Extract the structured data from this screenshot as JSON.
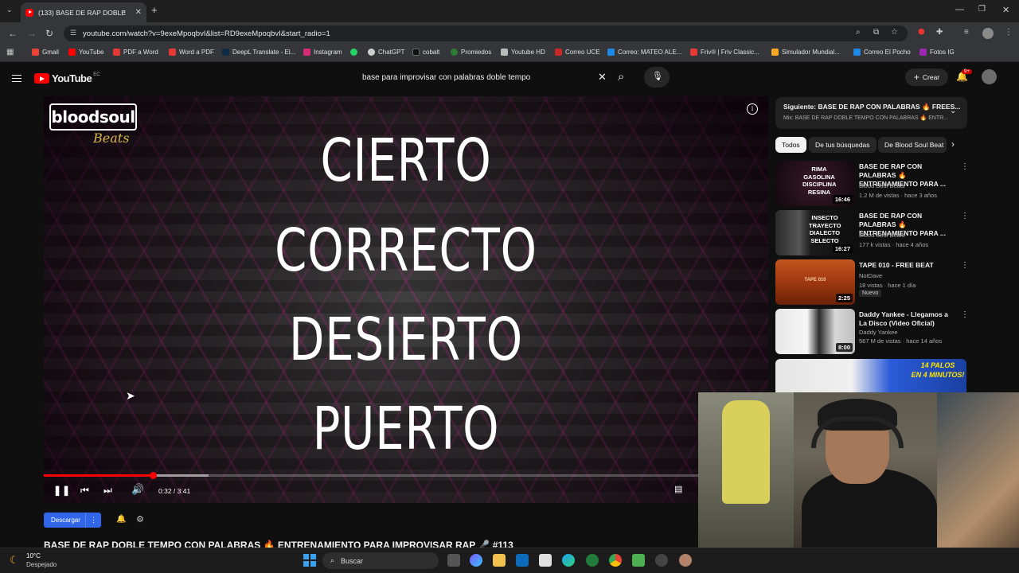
{
  "browser": {
    "tab_title": "(133) BASE DE RAP DOBLE",
    "url": "youtube.com/watch?v=9exeMpoqbvI&list=RD9exeMpoqbvI&start_radio=1",
    "bookmarks": [
      "Gmail",
      "YouTube",
      "PDF a Word",
      "Word a PDF",
      "DeepL Translate - El...",
      "Instagram",
      "ChatGPT",
      "cobalt",
      "Promiedos",
      "Youtube HD",
      "Correo UCE",
      "Correo: MATEO ALE...",
      "Friv® | Friv Classic...",
      "Simulador Mundial...",
      "Correo El Pocho",
      "Fotos IG"
    ]
  },
  "youtube": {
    "logo_text": "YouTube",
    "country": "EC",
    "search_value": "base para improvisar con palabras doble tempo",
    "create_label": "Crear",
    "notif_count": "9+"
  },
  "video": {
    "words": [
      "CIERTO",
      "CORRECTO",
      "DESIERTO",
      "PUERTO"
    ],
    "brand": "bloodsoul",
    "brand_sub": "Beats",
    "time": "0:32 / 3:41",
    "progress_fraction": 0.167,
    "buffer_fraction": 0.252,
    "download_label": "Descargar",
    "title": "BASE DE RAP DOBLE TEMPO CON PALABRAS 🔥 ENTRENAMIENTO PARA IMPROVISAR RAP 🎤 #113"
  },
  "sidebar": {
    "next_title": "Siguiente: BASE DE RAP CON PALABRAS 🔥 FREES...",
    "next_sub": "Mix: BASE DE RAP DOBLE TEMPO CON PALABRAS 🔥 ENTR...",
    "chips": [
      "Todos",
      "De tus búsquedas",
      "De Blood Soul Beat"
    ],
    "recs": [
      {
        "title": "BASE DE RAP CON PALABRAS 🔥 ENTRENAMIENTO PARA ...",
        "channel": "Blood Soul Beats",
        "meta": "1.2 M de vistas · hace 3 años",
        "duration": "16:46",
        "thumb_text": "RIMA\nGASOLINA\nDISCIPLINA\nRESINA"
      },
      {
        "title": "BASE DE RAP CON PALABRAS 🔥 ENTRENAMIENTO PARA ...",
        "channel": "Blood Soul Beats",
        "meta": "177 k vistas · hace 4 años",
        "duration": "16:27",
        "thumb_text": "INSECTO\nTRAYECTO\nDIALECTO\nSELECTO"
      },
      {
        "title": "TAPE 010 - FREE BEAT",
        "channel": "NotDave",
        "meta": "18 vistas · hace 1 día",
        "duration": "2:25",
        "badge": "Nuevo",
        "thumb_text": "TAPE 010"
      },
      {
        "title": "Daddy Yankee - Llegamos a La Disco (Video Oficial)",
        "channel": "Daddy Yankee",
        "meta": "567 M de vistas · hace 14 años",
        "duration": "8:00",
        "thumb_text": ""
      }
    ],
    "partial_thumb_text": "14 PALOS\nEN 4 MINUTOS!"
  },
  "taskbar": {
    "temp": "10°C",
    "weather": "Despejado",
    "search_label": "Buscar"
  },
  "colors": {
    "accent_red": "#ff0000",
    "download_blue": "#3166e8"
  }
}
